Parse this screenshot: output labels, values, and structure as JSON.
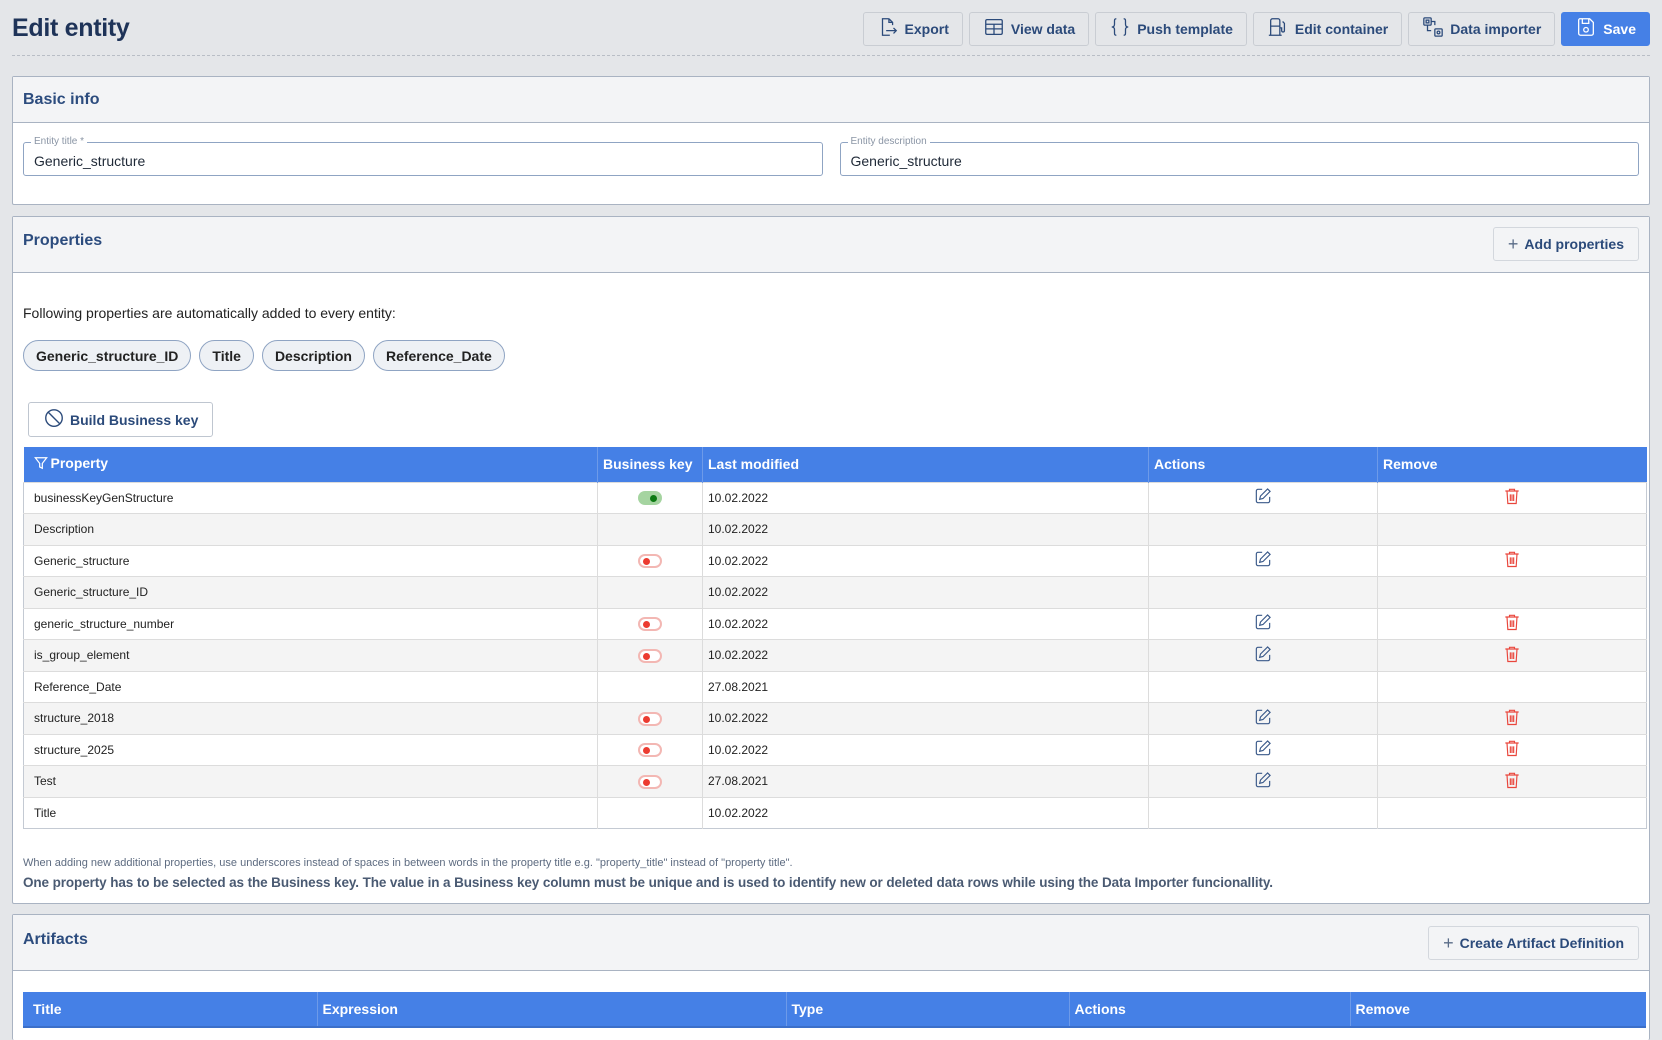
{
  "header": {
    "title": "Edit entity",
    "toolbar": [
      {
        "label": "Export",
        "icon": "export-icon"
      },
      {
        "label": "View data",
        "icon": "table-icon"
      },
      {
        "label": "Push template",
        "icon": "braces-icon"
      },
      {
        "label": "Edit container",
        "icon": "container-icon"
      },
      {
        "label": "Data importer",
        "icon": "data-importer-icon"
      },
      {
        "label": "Save",
        "icon": "save-icon",
        "primary": true
      }
    ]
  },
  "basic_info": {
    "title": "Basic info",
    "entity_title": {
      "label": "Entity title *",
      "value": "Generic_structure"
    },
    "entity_description": {
      "label": "Entity description",
      "value": "Generic_structure"
    }
  },
  "properties": {
    "title": "Properties",
    "add_button": "Add properties",
    "auto_text": "Following properties are automatically added to every entity:",
    "auto_chips": [
      "Generic_structure_ID",
      "Title",
      "Description",
      "Reference_Date"
    ],
    "build_key_button": "Build Business key",
    "columns": [
      "Property",
      "Business key",
      "Last modified",
      "Actions",
      "Remove"
    ],
    "rows": [
      {
        "property": "businessKeyGenStructure",
        "business_key": "on",
        "last_modified": "10.02.2022",
        "editable": true
      },
      {
        "property": "Description",
        "business_key": null,
        "last_modified": "10.02.2022",
        "editable": false
      },
      {
        "property": "Generic_structure",
        "business_key": "off",
        "last_modified": "10.02.2022",
        "editable": true
      },
      {
        "property": "Generic_structure_ID",
        "business_key": null,
        "last_modified": "10.02.2022",
        "editable": false
      },
      {
        "property": "generic_structure_number",
        "business_key": "off",
        "last_modified": "10.02.2022",
        "editable": true
      },
      {
        "property": "is_group_element",
        "business_key": "off",
        "last_modified": "10.02.2022",
        "editable": true
      },
      {
        "property": "Reference_Date",
        "business_key": null,
        "last_modified": "27.08.2021",
        "editable": false
      },
      {
        "property": "structure_2018",
        "business_key": "off",
        "last_modified": "10.02.2022",
        "editable": true
      },
      {
        "property": "structure_2025",
        "business_key": "off",
        "last_modified": "10.02.2022",
        "editable": true
      },
      {
        "property": "Test",
        "business_key": "off",
        "last_modified": "27.08.2021",
        "editable": true
      },
      {
        "property": "Title",
        "business_key": null,
        "last_modified": "10.02.2022",
        "editable": false
      }
    ],
    "hint_small": "When adding new additional properties, use underscores instead of spaces in between words in the property title e.g. \"property_title\" instead of \"property title\".",
    "hint_big": "One property has to be selected as the Business key. The value in a Business key column must be unique and is used to identify new or deleted data rows while using the Data Importer funcionallity."
  },
  "artifacts": {
    "title": "Artifacts",
    "create_button": "Create Artifact Definition",
    "columns": [
      "Title",
      "Expression",
      "Type",
      "Actions",
      "Remove"
    ]
  },
  "colors": {
    "accent": "#4580e6",
    "title": "#1e3358",
    "toggle_on": "#0c7a12",
    "toggle_off": "#ec3b30",
    "trash": "#e9463c"
  }
}
